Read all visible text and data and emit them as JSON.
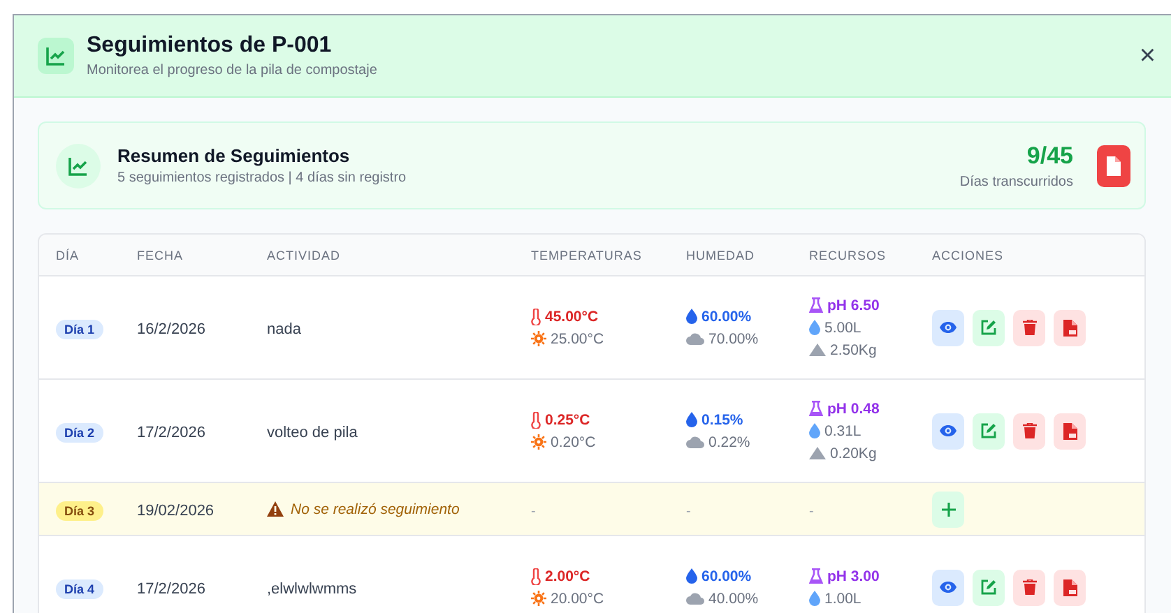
{
  "modal": {
    "title": "Seguimientos de P-001",
    "subtitle": "Monitorea el progreso de la pila de compostaje",
    "close": "×"
  },
  "summary": {
    "title": "Resumen de Seguimientos",
    "subtitle": "5 seguimientos registrados | 4 días sin registro",
    "count": "9/45",
    "count_label": "Días transcurridos"
  },
  "table": {
    "columns": [
      "DÍA",
      "FECHA",
      "ACTIVIDAD",
      "TEMPERATURAS",
      "HUMEDAD",
      "RECURSOS",
      "ACCIONES"
    ],
    "rows": [
      {
        "kind": "record",
        "day": "Día 1",
        "date": "16/2/2026",
        "activity": "nada",
        "temp_main": "45.00°C",
        "temp_ambient": "25.00°C",
        "humidity_main": "60.00%",
        "humidity_ambient": "70.00%",
        "ph": "pH 6.50",
        "water": "5.00L",
        "weight": "2.50Kg"
      },
      {
        "kind": "record",
        "day": "Día 2",
        "date": "17/2/2026",
        "activity": "volteo de pila",
        "temp_main": "0.25°C",
        "temp_ambient": "0.20°C",
        "humidity_main": "0.15%",
        "humidity_ambient": "0.22%",
        "ph": "pH 0.48",
        "water": "0.31L",
        "weight": "0.20Kg"
      },
      {
        "kind": "missing",
        "day": "Día 3",
        "date": "19/02/2026",
        "activity": "No se realizó seguimiento",
        "temperature": "-",
        "humidity": "-",
        "resources": "-"
      },
      {
        "kind": "record",
        "day": "Día 4",
        "date": "17/2/2026",
        "activity": ",elwlwlwmms",
        "temp_main": "2.00°C",
        "temp_ambient": "20.00°C",
        "humidity_main": "60.00%",
        "humidity_ambient": "40.00%",
        "ph": "pH 3.00",
        "water": "1.00L"
      }
    ]
  }
}
